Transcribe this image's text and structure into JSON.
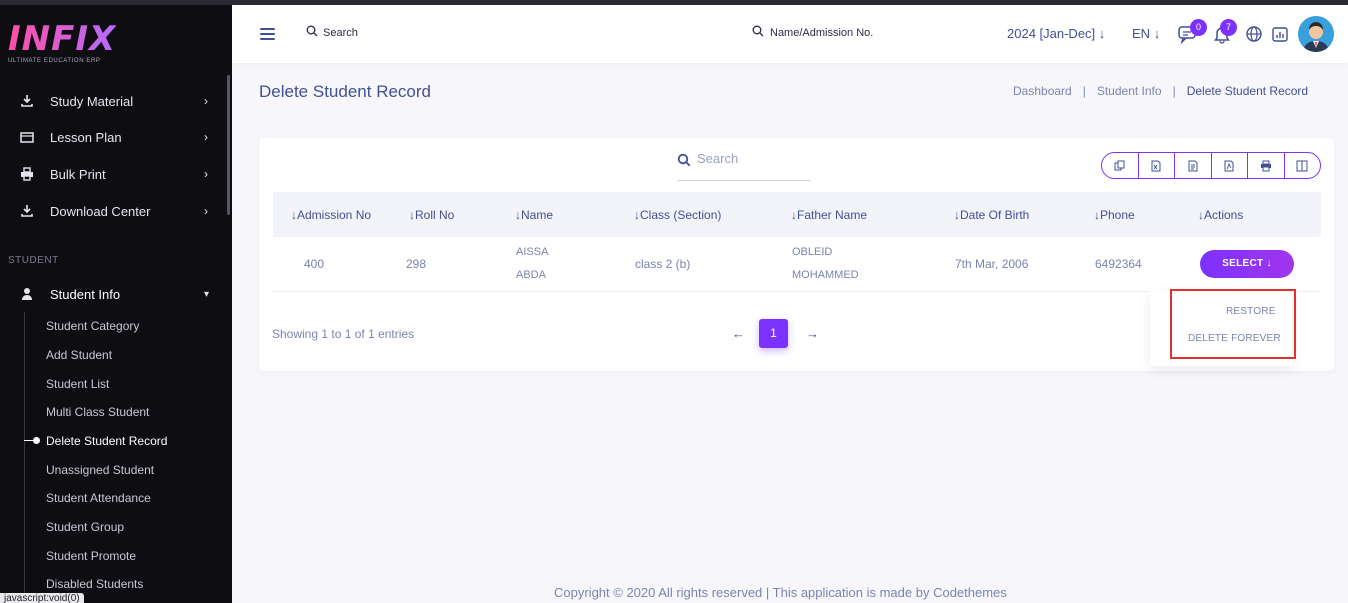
{
  "brand": {
    "logo": "INFIX",
    "tagline": "ULTIMATE EDUCATION ERP"
  },
  "sidebar": {
    "items": [
      {
        "label": "Study Material",
        "icon": "download-icon"
      },
      {
        "label": "Lesson Plan",
        "icon": "book-icon"
      },
      {
        "label": "Bulk Print",
        "icon": "printer-icon"
      },
      {
        "label": "Download Center",
        "icon": "download-icon"
      }
    ],
    "section": "STUDENT",
    "student_info": {
      "label": "Student Info",
      "icon": "user-icon"
    },
    "sub_items": [
      "Student Category",
      "Add Student",
      "Student List",
      "Multi Class Student",
      "Delete Student Record",
      "Unassigned Student",
      "Student Attendance",
      "Student Group",
      "Student Promote",
      "Disabled Students"
    ],
    "status_tip": "javascript:void(0)"
  },
  "header": {
    "search_label": "Search",
    "name_search": "Name/Admission No.",
    "year": "2024 [Jan-Dec]",
    "lang": "EN",
    "chat_badge": "0",
    "notif_badge": "7"
  },
  "page": {
    "title": "Delete Student Record",
    "breadcrumb": [
      "Dashboard",
      "Student Info",
      "Delete Student Record"
    ]
  },
  "table": {
    "search_placeholder": "Search",
    "columns": [
      "Admission No",
      "Roll No",
      "Name",
      "Class (Section)",
      "Father Name",
      "Date Of Birth",
      "Phone",
      "Actions"
    ],
    "rows": [
      {
        "admission_no": "400",
        "roll_no": "298",
        "name_1": "AISSA",
        "name_2": "ABDA",
        "class": "class 2 (b)",
        "father_1": "OBLEID",
        "father_2": "MOHAMMED",
        "dob": "7th Mar, 2006",
        "phone": "6492364",
        "action": "SELECT"
      }
    ],
    "showing": "Showing 1 to 1 of 1 entries",
    "page": "1",
    "dropdown": [
      "RESTORE",
      "DELETE FOREVER"
    ]
  },
  "footer": {
    "text": "Copyright © 2020 All rights reserved | This application is made by Codethemes"
  },
  "colors": {
    "accent": "#7c32ff",
    "primary_text": "#415094",
    "highlight": "#e03131"
  }
}
